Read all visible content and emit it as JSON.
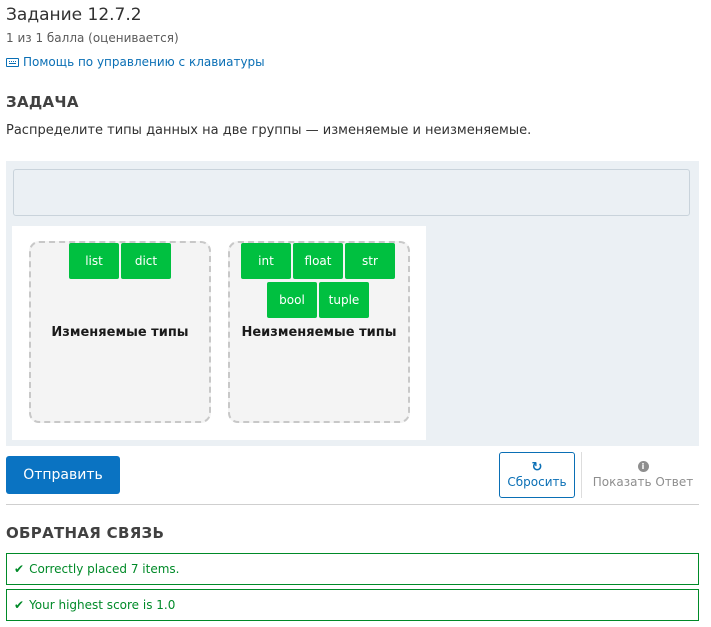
{
  "header": {
    "title": "Задание 12.7.2",
    "score": "1 из 1 балла (оценивается)",
    "keyboard_help": "Помощь по управлению с клавиатуры"
  },
  "problem": {
    "section_title": "ЗАДАЧА",
    "prompt": "Распределите типы данных на две группы — изменяемые и неизменяемые.",
    "zones": [
      {
        "label": "Изменяемые типы",
        "items": [
          "list",
          "dict"
        ]
      },
      {
        "label": "Неизменяемые типы",
        "items": [
          "int",
          "float",
          "str",
          "bool",
          "tuple"
        ]
      }
    ]
  },
  "actions": {
    "submit": "Отправить",
    "reset": "Сбросить",
    "show_answer": "Показать Ответ"
  },
  "feedback": {
    "section_title": "ОБРАТНАЯ СВЯЗЬ",
    "messages": [
      "Correctly placed 7 items.",
      "Your highest score is 1.0"
    ]
  },
  "colors": {
    "accent": "#0a73c2",
    "item": "#00c040",
    "success": "#008a28"
  },
  "icons": {
    "keyboard": "keyboard-icon",
    "reset": "refresh-icon",
    "show_answer": "info-icon",
    "feedback": "check-icon"
  }
}
